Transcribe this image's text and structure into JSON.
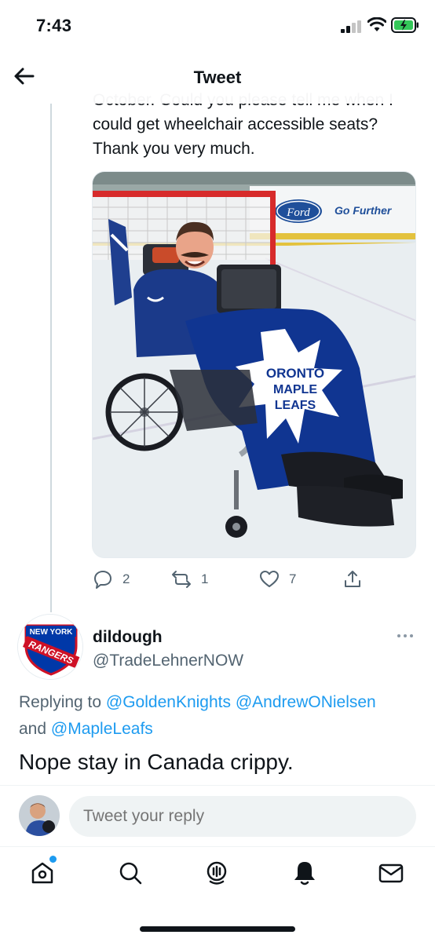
{
  "status": {
    "time": "7:43"
  },
  "header": {
    "title": "Tweet"
  },
  "tweet": {
    "text": "October. Could you please tell me when I could get wheelchair accessible seats? Thank you very much.",
    "media_texts": {
      "sponsor_brand": "Ford",
      "sponsor_slogan": "Go Further",
      "blanket_text_line1": "ORONTO",
      "blanket_text_line2": "MAPLE",
      "blanket_text_line3": "LEAFS"
    },
    "replies": "2",
    "retweets": "1",
    "likes": "7"
  },
  "reply": {
    "display_name": "dildough",
    "handle": "@TradeLehnerNOW",
    "replying_prefix": "Replying to",
    "mention1": "@GoldenKnights",
    "mention2": "@AndrewONielsen",
    "and": "and",
    "mention3": "@MapleLeafs",
    "text": "Nope stay in Canada crippy.",
    "avatar_text_top": "NEW YORK",
    "avatar_text_main": "RANGERS"
  },
  "compose": {
    "placeholder": "Tweet your reply"
  },
  "colors": {
    "accent": "#1d9bf0",
    "text": "#0f1419",
    "secondary": "#536471",
    "leafs_blue": "#00205b",
    "rangers_blue": "#0038a8",
    "rangers_red": "#ce1126"
  }
}
